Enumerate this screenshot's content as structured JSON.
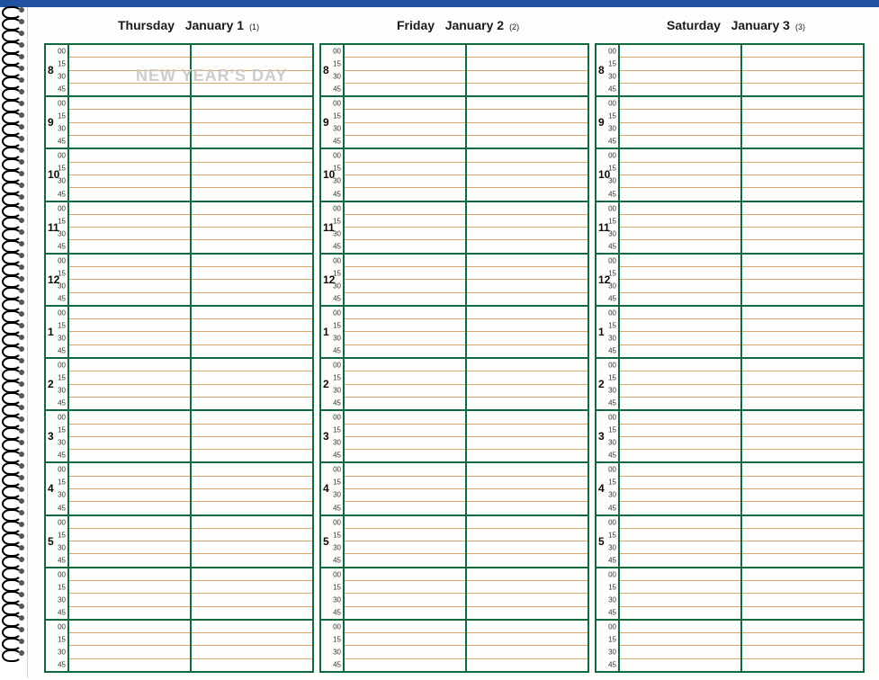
{
  "days": [
    {
      "weekday": "Thursday",
      "date": "January 1",
      "day_of_year": "(1)",
      "holiday": "NEW YEAR'S DAY"
    },
    {
      "weekday": "Friday",
      "date": "January 2",
      "day_of_year": "(2)",
      "holiday": ""
    },
    {
      "weekday": "Saturday",
      "date": "January 3",
      "day_of_year": "(3)",
      "holiday": ""
    }
  ],
  "hours": [
    "8",
    "9",
    "10",
    "11",
    "12",
    "1",
    "2",
    "3",
    "4",
    "5",
    "",
    ""
  ],
  "minutes": [
    "00",
    "15",
    "30",
    "45"
  ]
}
